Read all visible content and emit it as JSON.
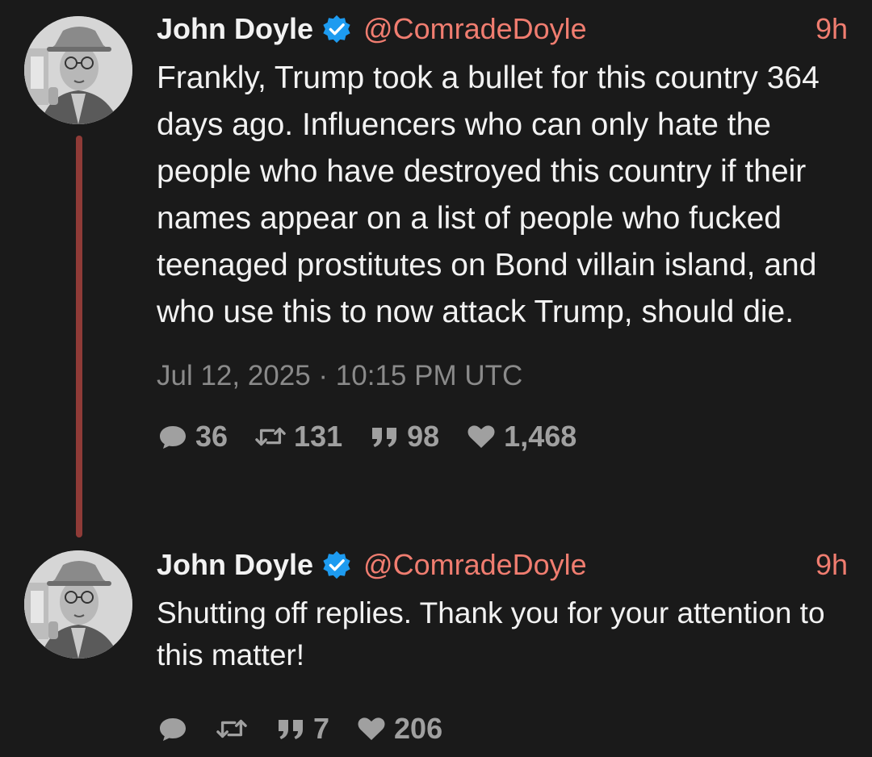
{
  "icons": {
    "verified": "verified-badge-icon",
    "reply": "comment-bubble-icon",
    "retweet": "retweet-icon",
    "quote": "quote-icon",
    "like": "heart-icon"
  },
  "colors": {
    "background": "#1a1a1a",
    "handle": "#f07d70",
    "thread_line": "#8f3b37",
    "verified": "#1d9bf0",
    "muted": "#8a8a8a"
  },
  "tweets": [
    {
      "display_name": "John Doyle",
      "handle": "@ComradeDoyle",
      "time": "9h",
      "text": "Frankly, Trump took a bullet for this country 364 days ago. Influencers who can only hate the people who have destroyed this country if their names appear on a list of people who fucked teenaged prostitutes on Bond villain island, and who use this to now attack Trump, should die.",
      "date": "Jul 12, 2025 · 10:15 PM UTC",
      "stats": {
        "replies": "36",
        "retweets": "131",
        "quotes": "98",
        "likes": "1,468"
      }
    },
    {
      "display_name": "John Doyle",
      "handle": "@ComradeDoyle",
      "time": "9h",
      "text": "Shutting off replies. Thank you for your attention to this matter!",
      "stats": {
        "replies": "",
        "retweets": "",
        "quotes": "7",
        "likes": "206"
      }
    }
  ]
}
